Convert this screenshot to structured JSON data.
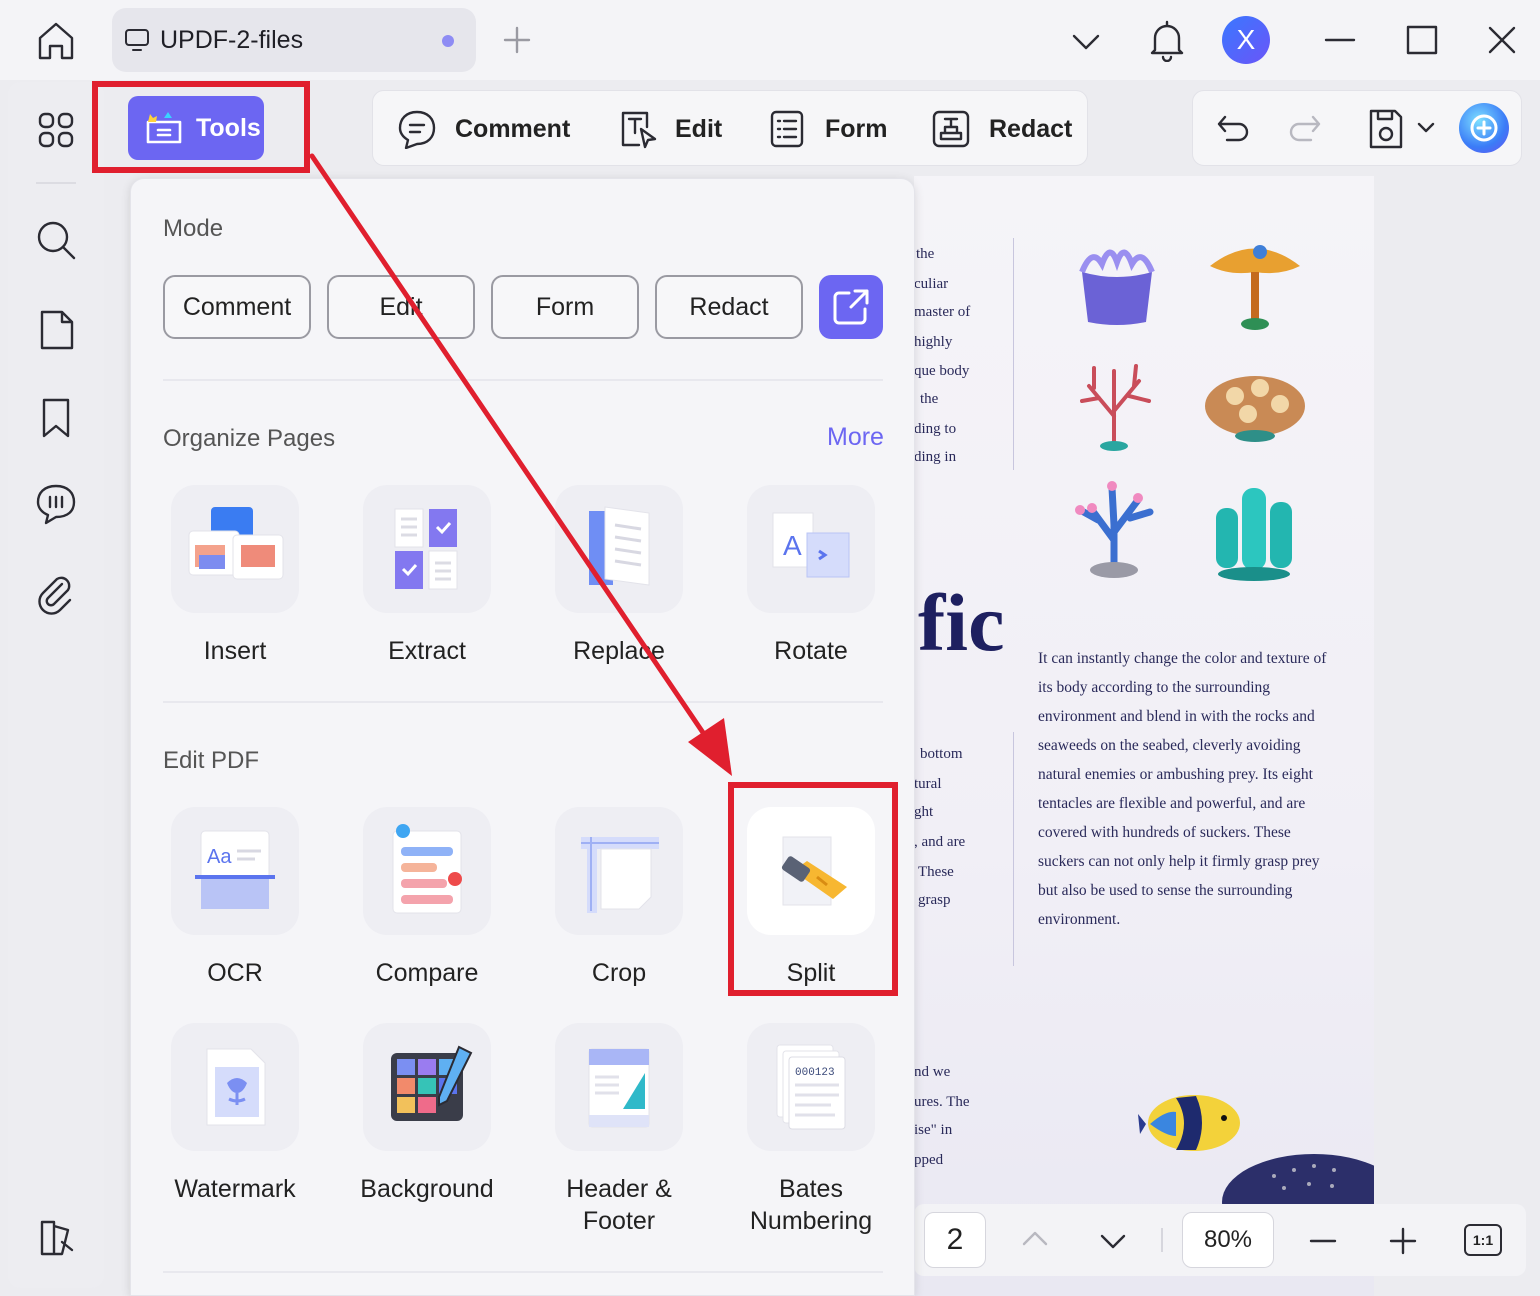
{
  "titlebar": {
    "tab_title": "UPDF-2-files",
    "avatar_initial": "X"
  },
  "toolbar": {
    "tools_label": "Tools",
    "modes": [
      "Comment",
      "Edit",
      "Form",
      "Redact"
    ]
  },
  "panel": {
    "mode_section_title": "Mode",
    "mode_buttons": [
      "Comment",
      "Edit",
      "Form",
      "Redact"
    ],
    "organize_section_title": "Organize Pages",
    "more_link": "More",
    "organize_tools": [
      "Insert",
      "Extract",
      "Replace",
      "Rotate"
    ],
    "edit_section_title": "Edit PDF",
    "edit_tools_row1": [
      "OCR",
      "Compare",
      "Crop",
      "Split"
    ],
    "edit_tools_row2": [
      "Watermark",
      "Background",
      "Header &\nFooter",
      "Bates\nNumbering"
    ]
  },
  "document": {
    "fragments_top": [
      "the",
      "culiar",
      "master of",
      "highly",
      "que body",
      "the",
      "ding to",
      "ding in"
    ],
    "big_text": "fic",
    "body_text": "It can instantly change the color and texture of its body according to the surrounding environment and blend in with the rocks and seaweeds on the seabed, cleverly avoiding natural enemies or ambushing prey. Its eight tentacles are flexible and powerful, and are covered with hundreds of suckers. These suckers can not only help it firmly grasp prey but also be used to sense the surrounding environment.",
    "fragments_mid": [
      "bottom",
      "tural",
      "ght",
      ", and are",
      "These",
      "grasp"
    ],
    "fragments_bottom": [
      "nd we",
      "ures. The",
      "ise\" in",
      "pped"
    ]
  },
  "bottombar": {
    "page_number": "2",
    "zoom": "80%",
    "fit_label": "1:1"
  },
  "colors": {
    "accent": "#6c66f2",
    "highlight": "#e01f2e"
  }
}
